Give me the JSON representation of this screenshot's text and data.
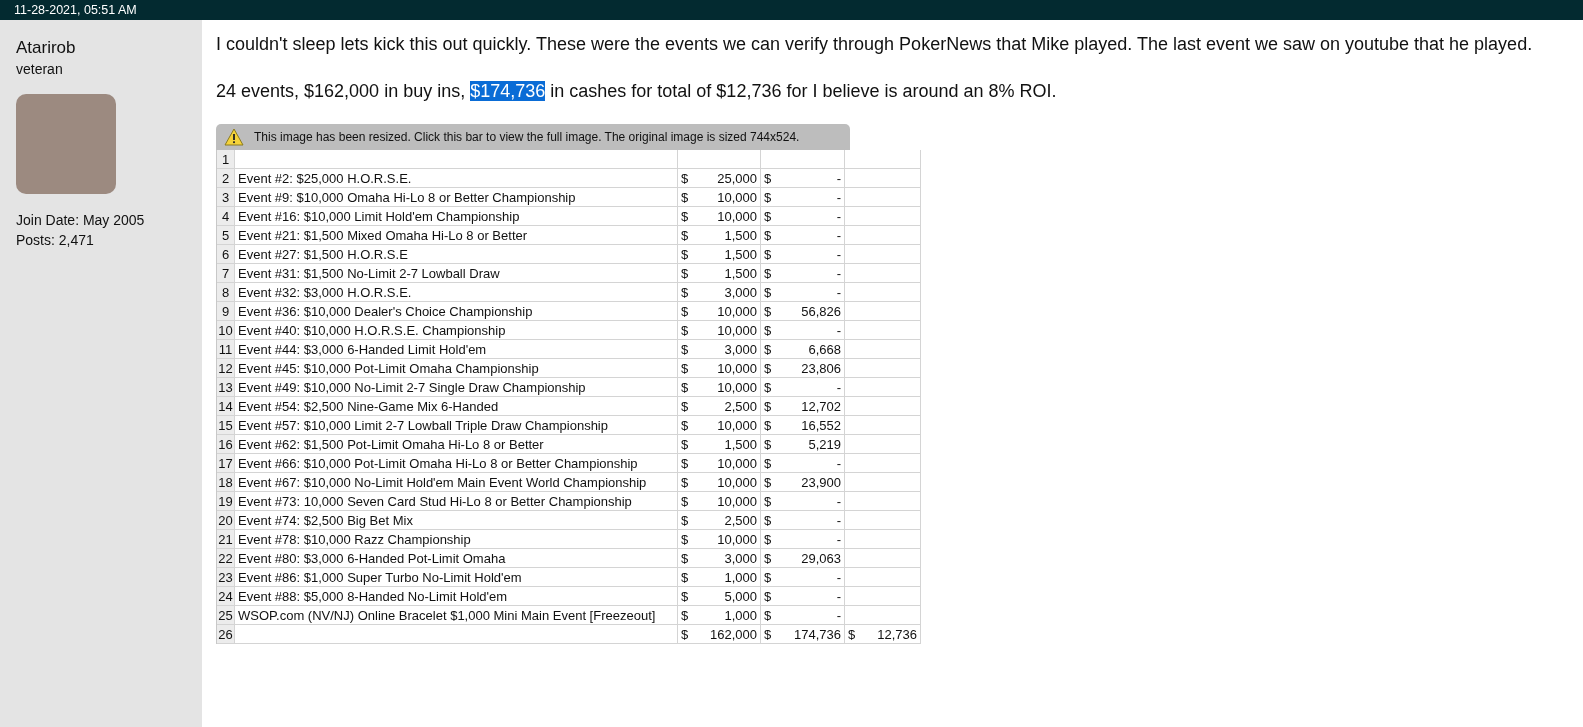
{
  "post_header": {
    "date": "11-28-2021, 05:51 AM"
  },
  "author": {
    "name": "Atarirob",
    "rank": "veteran",
    "join_date": "Join Date: May 2005",
    "posts": "Posts: 2,471"
  },
  "post": {
    "paragraphs": [
      [
        {
          "text": "I couldn't sleep lets kick this out quickly. These were the events we can verify through PokerNews that Mike played. The last event we saw on youtube that he played.",
          "selected": false
        }
      ],
      [
        {
          "text": "24 events, $162,000 in buy ins, ",
          "selected": false
        },
        {
          "text": "$174,736",
          "selected": true
        },
        {
          "text": " in cashes for total of $12,736 for I believe is around an 8% ROI.",
          "selected": false
        }
      ]
    ],
    "resize_notice": "This image has been resized. Click this bar to view the full image. The original image is sized 744x524.",
    "table": {
      "rows": [
        {
          "row": "1"
        },
        {
          "row": "2",
          "event": "Event #2: $25,000 H.O.R.S.E.",
          "buy_in": {
            "sign": "$",
            "amount": "25,000"
          },
          "cash": {
            "sign": "$",
            "amount": "-"
          }
        },
        {
          "row": "3",
          "event": "Event #9: $10,000 Omaha Hi-Lo 8 or Better Championship",
          "buy_in": {
            "sign": "$",
            "amount": "10,000"
          },
          "cash": {
            "sign": "$",
            "amount": "-"
          }
        },
        {
          "row": "4",
          "event": "Event #16: $10,000 Limit Hold'em Championship",
          "buy_in": {
            "sign": "$",
            "amount": "10,000"
          },
          "cash": {
            "sign": "$",
            "amount": "-"
          }
        },
        {
          "row": "5",
          "event": "Event #21: $1,500 Mixed Omaha Hi-Lo 8 or Better",
          "buy_in": {
            "sign": "$",
            "amount": "1,500"
          },
          "cash": {
            "sign": "$",
            "amount": "-"
          }
        },
        {
          "row": "6",
          "event": "Event #27: $1,500 H.O.R.S.E",
          "buy_in": {
            "sign": "$",
            "amount": "1,500"
          },
          "cash": {
            "sign": "$",
            "amount": "-"
          }
        },
        {
          "row": "7",
          "event": "Event #31: $1,500 No-Limit 2-7 Lowball Draw",
          "buy_in": {
            "sign": "$",
            "amount": "1,500"
          },
          "cash": {
            "sign": "$",
            "amount": "-"
          }
        },
        {
          "row": "8",
          "event": "Event #32: $3,000 H.O.R.S.E.",
          "buy_in": {
            "sign": "$",
            "amount": "3,000"
          },
          "cash": {
            "sign": "$",
            "amount": "-"
          }
        },
        {
          "row": "9",
          "event": "Event #36: $10,000 Dealer's Choice Championship",
          "buy_in": {
            "sign": "$",
            "amount": "10,000"
          },
          "cash": {
            "sign": "$",
            "amount": "56,826"
          }
        },
        {
          "row": "10",
          "event": "Event #40: $10,000 H.O.R.S.E. Championship",
          "buy_in": {
            "sign": "$",
            "amount": "10,000"
          },
          "cash": {
            "sign": "$",
            "amount": "-"
          }
        },
        {
          "row": "11",
          "event": "Event #44: $3,000 6-Handed Limit Hold'em",
          "buy_in": {
            "sign": "$",
            "amount": "3,000"
          },
          "cash": {
            "sign": "$",
            "amount": "6,668"
          }
        },
        {
          "row": "12",
          "event": "Event #45: $10,000 Pot-Limit Omaha Championship",
          "buy_in": {
            "sign": "$",
            "amount": "10,000"
          },
          "cash": {
            "sign": "$",
            "amount": "23,806"
          }
        },
        {
          "row": "13",
          "event": "Event #49: $10,000 No-Limit 2-7 Single Draw Championship",
          "buy_in": {
            "sign": "$",
            "amount": "10,000"
          },
          "cash": {
            "sign": "$",
            "amount": "-"
          }
        },
        {
          "row": "14",
          "event": "Event #54: $2,500 Nine-Game Mix 6-Handed",
          "buy_in": {
            "sign": "$",
            "amount": "2,500"
          },
          "cash": {
            "sign": "$",
            "amount": "12,702"
          }
        },
        {
          "row": "15",
          "event": "Event #57: $10,000 Limit 2-7 Lowball Triple Draw Championship",
          "buy_in": {
            "sign": "$",
            "amount": "10,000"
          },
          "cash": {
            "sign": "$",
            "amount": "16,552"
          }
        },
        {
          "row": "16",
          "event": "Event #62: $1,500 Pot-Limit Omaha Hi-Lo 8 or Better",
          "buy_in": {
            "sign": "$",
            "amount": "1,500"
          },
          "cash": {
            "sign": "$",
            "amount": "5,219"
          }
        },
        {
          "row": "17",
          "event": "Event #66: $10,000 Pot-Limit Omaha Hi-Lo 8 or Better Championship",
          "buy_in": {
            "sign": "$",
            "amount": "10,000"
          },
          "cash": {
            "sign": "$",
            "amount": "-"
          }
        },
        {
          "row": "18",
          "event": "Event #67: $10,000 No-Limit Hold'em Main Event World Championship",
          "buy_in": {
            "sign": "$",
            "amount": "10,000"
          },
          "cash": {
            "sign": "$",
            "amount": "23,900"
          }
        },
        {
          "row": "19",
          "event": "Event #73: 10,000 Seven Card Stud Hi-Lo 8 or Better Championship",
          "buy_in": {
            "sign": "$",
            "amount": "10,000"
          },
          "cash": {
            "sign": "$",
            "amount": "-"
          }
        },
        {
          "row": "20",
          "event": "Event #74: $2,500 Big Bet Mix",
          "buy_in": {
            "sign": "$",
            "amount": "2,500"
          },
          "cash": {
            "sign": "$",
            "amount": "-"
          }
        },
        {
          "row": "21",
          "event": "Event #78: $10,000 Razz Championship",
          "buy_in": {
            "sign": "$",
            "amount": "10,000"
          },
          "cash": {
            "sign": "$",
            "amount": "-"
          }
        },
        {
          "row": "22",
          "event": "Event #80: $3,000 6-Handed Pot-Limit Omaha",
          "buy_in": {
            "sign": "$",
            "amount": "3,000"
          },
          "cash": {
            "sign": "$",
            "amount": "29,063"
          }
        },
        {
          "row": "23",
          "event": "Event #86: $1,000 Super Turbo No-Limit Hold'em",
          "buy_in": {
            "sign": "$",
            "amount": "1,000"
          },
          "cash": {
            "sign": "$",
            "amount": "-"
          }
        },
        {
          "row": "24",
          "event": "Event #88: $5,000 8-Handed No-Limit Hold'em",
          "buy_in": {
            "sign": "$",
            "amount": "5,000"
          },
          "cash": {
            "sign": "$",
            "amount": "-"
          }
        },
        {
          "row": "25",
          "event": "WSOP.com (NV/NJ) Online Bracelet $1,000 Mini Main Event [Freezeout]",
          "buy_in": {
            "sign": "$",
            "amount": "1,000"
          },
          "cash": {
            "sign": "$",
            "amount": "-"
          }
        },
        {
          "row": "26",
          "buy_in": {
            "sign": "$",
            "amount": "162,000"
          },
          "cash": {
            "sign": "$",
            "amount": "174,736"
          },
          "net": {
            "sign": "$",
            "amount": "12,736"
          }
        }
      ]
    }
  }
}
